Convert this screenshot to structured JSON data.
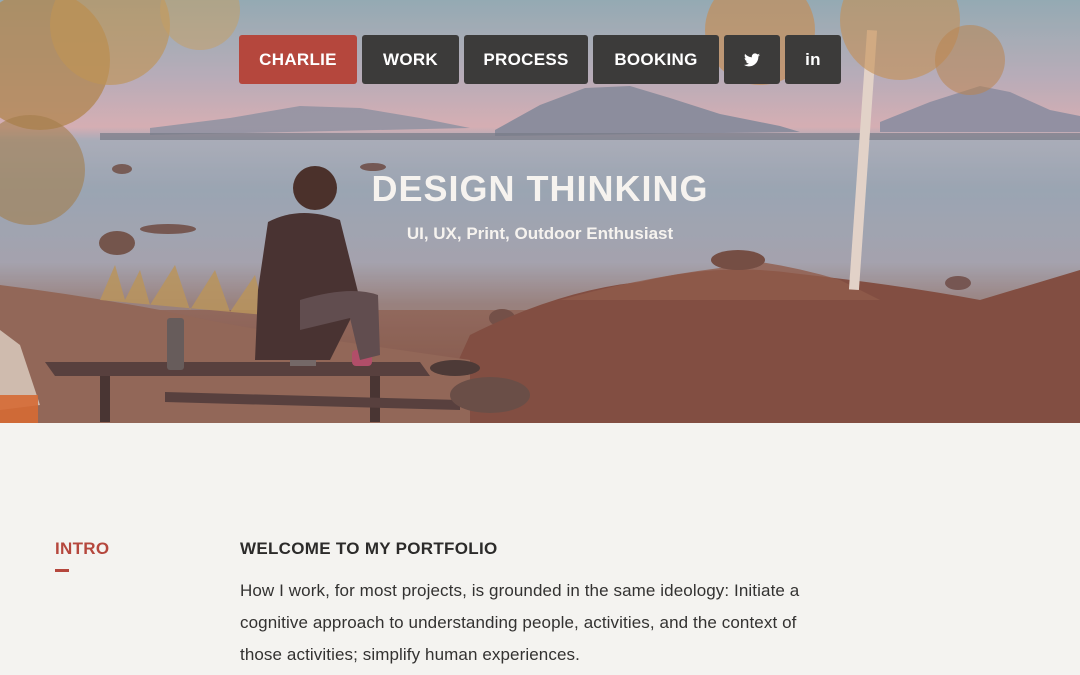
{
  "nav": {
    "items": [
      {
        "label": "CHARLIE",
        "active": true
      },
      {
        "label": "WORK",
        "active": false
      },
      {
        "label": "PROCESS",
        "active": false
      },
      {
        "label": "BOOKING",
        "active": false
      }
    ],
    "social": [
      {
        "icon": "twitter-icon",
        "glyph": "🐦"
      },
      {
        "icon": "linkedin-icon",
        "glyph": "in"
      }
    ]
  },
  "hero": {
    "title": "DESIGN THINKING",
    "subtitle": "UI, UX, Print, Outdoor Enthusiast"
  },
  "intro": {
    "section_label": "INTRO",
    "heading": "WELCOME TO MY PORTFOLIO",
    "body": "How I work, for most projects, is grounded in the same ideology: Initiate a cognitive approach to understanding people, activities, and the context of those activities; simplify human experiences."
  },
  "colors": {
    "accent": "#b5473d",
    "nav_bg": "#3c3b3a",
    "page_bg": "#f4f3f0"
  }
}
